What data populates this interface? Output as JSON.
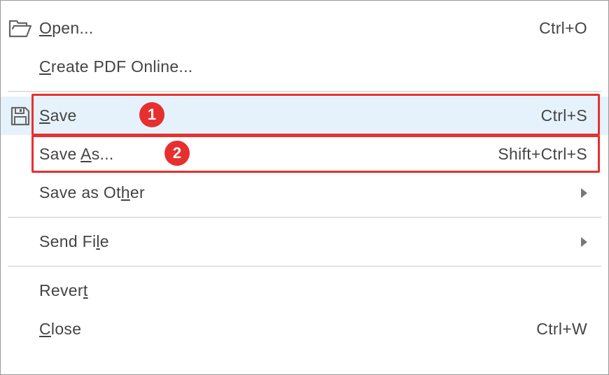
{
  "menu": {
    "open": {
      "label_pre": "",
      "label_u": "O",
      "label_post": "pen...",
      "shortcut": "Ctrl+O"
    },
    "create_pdf": {
      "label_pre": "",
      "label_u": "C",
      "label_post": "reate PDF Online..."
    },
    "save": {
      "label_pre": "",
      "label_u": "S",
      "label_post": "ave",
      "shortcut": "Ctrl+S"
    },
    "save_as": {
      "label_pre": "Save ",
      "label_u": "A",
      "label_post": "s...",
      "shortcut": "Shift+Ctrl+S"
    },
    "save_as_other": {
      "label_pre": "Save as Ot",
      "label_u": "h",
      "label_post": "er"
    },
    "send_file": {
      "label_pre": "Send Fi",
      "label_u": "l",
      "label_post": "e"
    },
    "revert": {
      "label_pre": "Rever",
      "label_u": "t",
      "label_post": ""
    },
    "close": {
      "label_pre": "",
      "label_u": "C",
      "label_post": "lose",
      "shortcut": "Ctrl+W"
    }
  },
  "annotations": {
    "badge1": "1",
    "badge2": "2"
  }
}
